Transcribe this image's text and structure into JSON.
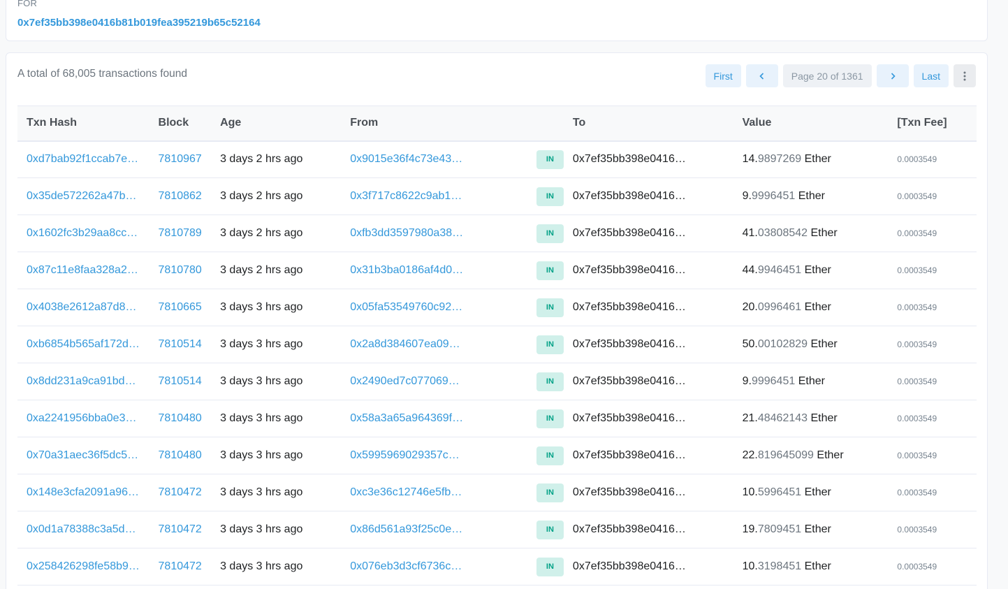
{
  "header": {
    "for_label": "FOR",
    "address": "0x7ef35bb398e0416b81b019fea395219b65c52164"
  },
  "summary": {
    "total_text": "A total of 68,005 transactions found"
  },
  "pager": {
    "first": "First",
    "page_info": "Page 20 of 1361",
    "last": "Last",
    "prev_icon": "chevron-left-icon",
    "next_icon": "chevron-right-icon",
    "more_icon": "vertical-dots-icon"
  },
  "colors": {
    "link": "#3498db",
    "badge_in_bg": "#d0f0ea",
    "badge_in_text": "#00a186"
  },
  "table": {
    "columns": [
      "Txn Hash",
      "Block",
      "Age",
      "From",
      "",
      "To",
      "Value",
      "[Txn Fee]"
    ],
    "rows": [
      {
        "hash": "0xd7bab92f1ccab7e…",
        "block": "7810967",
        "age": "3 days 2 hrs ago",
        "from": "0x9015e36f4c73e43…",
        "dir": "IN",
        "to": "0x7ef35bb398e0416…",
        "value_int": "14.",
        "value_dec": "9897269",
        "value_unit": " Ether",
        "fee": "0.0003549"
      },
      {
        "hash": "0x35de572262a47b…",
        "block": "7810862",
        "age": "3 days 2 hrs ago",
        "from": "0x3f717c8622c9ab1…",
        "dir": "IN",
        "to": "0x7ef35bb398e0416…",
        "value_int": "9.",
        "value_dec": "9996451",
        "value_unit": " Ether",
        "fee": "0.0003549"
      },
      {
        "hash": "0x1602fc3b29aa8cc…",
        "block": "7810789",
        "age": "3 days 2 hrs ago",
        "from": "0xfb3dd3597980a38…",
        "dir": "IN",
        "to": "0x7ef35bb398e0416…",
        "value_int": "41.",
        "value_dec": "03808542",
        "value_unit": " Ether",
        "fee": "0.0003549"
      },
      {
        "hash": "0x87c11e8faa328a2…",
        "block": "7810780",
        "age": "3 days 2 hrs ago",
        "from": "0x31b3ba0186af4d0…",
        "dir": "IN",
        "to": "0x7ef35bb398e0416…",
        "value_int": "44.",
        "value_dec": "9946451",
        "value_unit": " Ether",
        "fee": "0.0003549"
      },
      {
        "hash": "0x4038e2612a87d8…",
        "block": "7810665",
        "age": "3 days 3 hrs ago",
        "from": "0x05fa53549760c92…",
        "dir": "IN",
        "to": "0x7ef35bb398e0416…",
        "value_int": "20.",
        "value_dec": "0996461",
        "value_unit": " Ether",
        "fee": "0.0003549"
      },
      {
        "hash": "0xb6854b565af172d…",
        "block": "7810514",
        "age": "3 days 3 hrs ago",
        "from": "0x2a8d384607ea09…",
        "dir": "IN",
        "to": "0x7ef35bb398e0416…",
        "value_int": "50.",
        "value_dec": "00102829",
        "value_unit": " Ether",
        "fee": "0.0003549"
      },
      {
        "hash": "0x8dd231a9ca91bd…",
        "block": "7810514",
        "age": "3 days 3 hrs ago",
        "from": "0x2490ed7c077069…",
        "dir": "IN",
        "to": "0x7ef35bb398e0416…",
        "value_int": "9.",
        "value_dec": "9996451",
        "value_unit": " Ether",
        "fee": "0.0003549"
      },
      {
        "hash": "0xa2241956bba0e3…",
        "block": "7810480",
        "age": "3 days 3 hrs ago",
        "from": "0x58a3a65a964369f…",
        "dir": "IN",
        "to": "0x7ef35bb398e0416…",
        "value_int": "21.",
        "value_dec": "48462143",
        "value_unit": " Ether",
        "fee": "0.0003549"
      },
      {
        "hash": "0x70a31aec36f5dc5…",
        "block": "7810480",
        "age": "3 days 3 hrs ago",
        "from": "0x5995969029357c…",
        "dir": "IN",
        "to": "0x7ef35bb398e0416…",
        "value_int": "22.",
        "value_dec": "819645099",
        "value_unit": " Ether",
        "fee": "0.0003549"
      },
      {
        "hash": "0x148e3cfa2091a96…",
        "block": "7810472",
        "age": "3 days 3 hrs ago",
        "from": "0xc3e36c12746e5fb…",
        "dir": "IN",
        "to": "0x7ef35bb398e0416…",
        "value_int": "10.",
        "value_dec": "5996451",
        "value_unit": " Ether",
        "fee": "0.0003549"
      },
      {
        "hash": "0x0d1a78388c3a5d…",
        "block": "7810472",
        "age": "3 days 3 hrs ago",
        "from": "0x86d561a93f25c0e…",
        "dir": "IN",
        "to": "0x7ef35bb398e0416…",
        "value_int": "19.",
        "value_dec": "7809451",
        "value_unit": " Ether",
        "fee": "0.0003549"
      },
      {
        "hash": "0x258426298fe58b9…",
        "block": "7810472",
        "age": "3 days 3 hrs ago",
        "from": "0x076eb3d3cf6736c…",
        "dir": "IN",
        "to": "0x7ef35bb398e0416…",
        "value_int": "10.",
        "value_dec": "3198451",
        "value_unit": " Ether",
        "fee": "0.0003549"
      }
    ]
  }
}
